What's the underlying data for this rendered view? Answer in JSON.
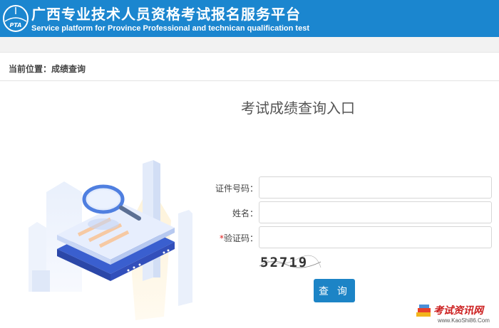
{
  "header": {
    "title": "广西专业技术人员资格考试报名服务平台",
    "subtitle": "Service platform for Province Professional and technican qualification test",
    "logo_text": "PTA",
    "bg_color": "#1b86cf"
  },
  "breadcrumb": {
    "prefix": "当前位置：",
    "current": "成绩查询"
  },
  "form": {
    "title": "考试成绩查询入口",
    "fields": [
      {
        "label": "证件号码：",
        "required": false,
        "value": ""
      },
      {
        "label": "姓名：",
        "required": false,
        "value": ""
      },
      {
        "label": "验证码：",
        "required": true,
        "required_mark": "*",
        "value": ""
      }
    ],
    "captcha_text": "52719",
    "submit_label": "查 询",
    "accent_color": "#1c84c6"
  },
  "watermark": {
    "text": "考试资讯网",
    "url": "www.KaoShi86.Com"
  }
}
